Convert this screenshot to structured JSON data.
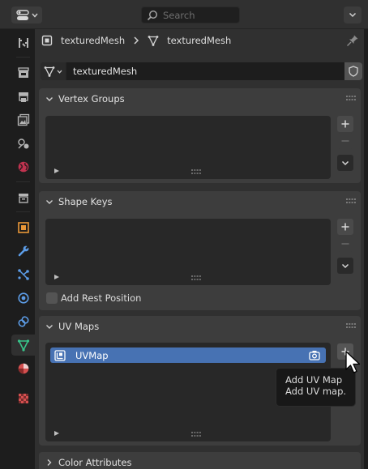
{
  "header": {
    "search_placeholder": "Search",
    "editor_type_icon": "properties-editor-icon"
  },
  "sidebar": {
    "tabs": [
      {
        "name": "tool",
        "icon": "tool-icon",
        "color": "#b5b5b5"
      },
      {
        "name": "render",
        "icon": "render-icon",
        "color": "#b5b5b5"
      },
      {
        "name": "output",
        "icon": "output-icon",
        "color": "#b5b5b5"
      },
      {
        "name": "view-layer",
        "icon": "view-layer-icon",
        "color": "#b5b5b5"
      },
      {
        "name": "scene",
        "icon": "scene-icon",
        "color": "#b5b5b5"
      },
      {
        "name": "world",
        "icon": "world-icon",
        "color": "#c0334f"
      },
      {
        "name": "collection",
        "icon": "collection-icon",
        "color": "#b5b5b5"
      },
      {
        "name": "object",
        "icon": "object-icon",
        "color": "#e89637"
      },
      {
        "name": "modifiers",
        "icon": "modifier-wrench-icon",
        "color": "#5c9ce6"
      },
      {
        "name": "particles",
        "icon": "particles-icon",
        "color": "#5c9ce6"
      },
      {
        "name": "physics",
        "icon": "physics-icon",
        "color": "#5c9ce6"
      },
      {
        "name": "constraints",
        "icon": "object-constraint-icon",
        "color": "#5c9ce6"
      },
      {
        "name": "data",
        "icon": "mesh-data-icon",
        "color": "#38c38a",
        "active": true
      },
      {
        "name": "material",
        "icon": "material-icon",
        "color": "#d44f4f"
      },
      {
        "name": "texture",
        "icon": "texture-checker-icon",
        "color": "#d44f4f"
      }
    ]
  },
  "breadcrumb": {
    "object_name": "texturedMesh",
    "mesh_name": "texturedMesh"
  },
  "datablock": {
    "name": "texturedMesh"
  },
  "panels": {
    "vertex_groups": {
      "title": "Vertex Groups"
    },
    "shape_keys": {
      "title": "Shape Keys",
      "add_rest_position_label": "Add Rest Position",
      "add_rest_position_checked": false
    },
    "uv_maps": {
      "title": "UV Maps",
      "items": [
        {
          "name": "UVMap",
          "active": true
        }
      ]
    },
    "color_attributes": {
      "title": "Color Attributes"
    }
  },
  "tooltip": {
    "title": "Add UV Map",
    "description": "Add UV map."
  },
  "colors": {
    "active_row": "#4772b3",
    "panel_bg": "#3d3d3d",
    "editor_bg": "#303030",
    "list_bg": "#282828",
    "mesh_accent": "#38c38a"
  }
}
